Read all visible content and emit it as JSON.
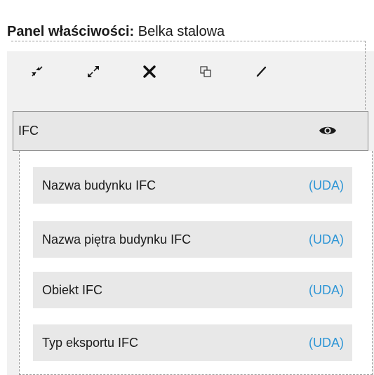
{
  "panel": {
    "title_label": "Panel właściwości:",
    "title_value": "Belka stalowa"
  },
  "toolbar": {
    "buttons": [
      {
        "name": "collapse-all",
        "icon": "collapse-arrows-icon"
      },
      {
        "name": "expand-all",
        "icon": "expand-arrows-icon"
      },
      {
        "name": "delete",
        "icon": "close-icon"
      },
      {
        "name": "copy",
        "icon": "copy-icon"
      },
      {
        "name": "edit",
        "icon": "pencil-icon"
      }
    ]
  },
  "group": {
    "label": "IFC",
    "visibility_icon": "eye-icon"
  },
  "properties": [
    {
      "name": "Nazwa budynku IFC",
      "tag": "(UDA)"
    },
    {
      "name": "Nazwa piętra budynku IFC",
      "tag": "(UDA)"
    },
    {
      "name": "Obiekt IFC",
      "tag": "(UDA)"
    },
    {
      "name": "Typ eksportu IFC",
      "tag": "(UDA)"
    }
  ],
  "colors": {
    "tag": "#2f96d6",
    "panel_background": "#f1f1f1",
    "row_background": "#e8e8e8"
  }
}
